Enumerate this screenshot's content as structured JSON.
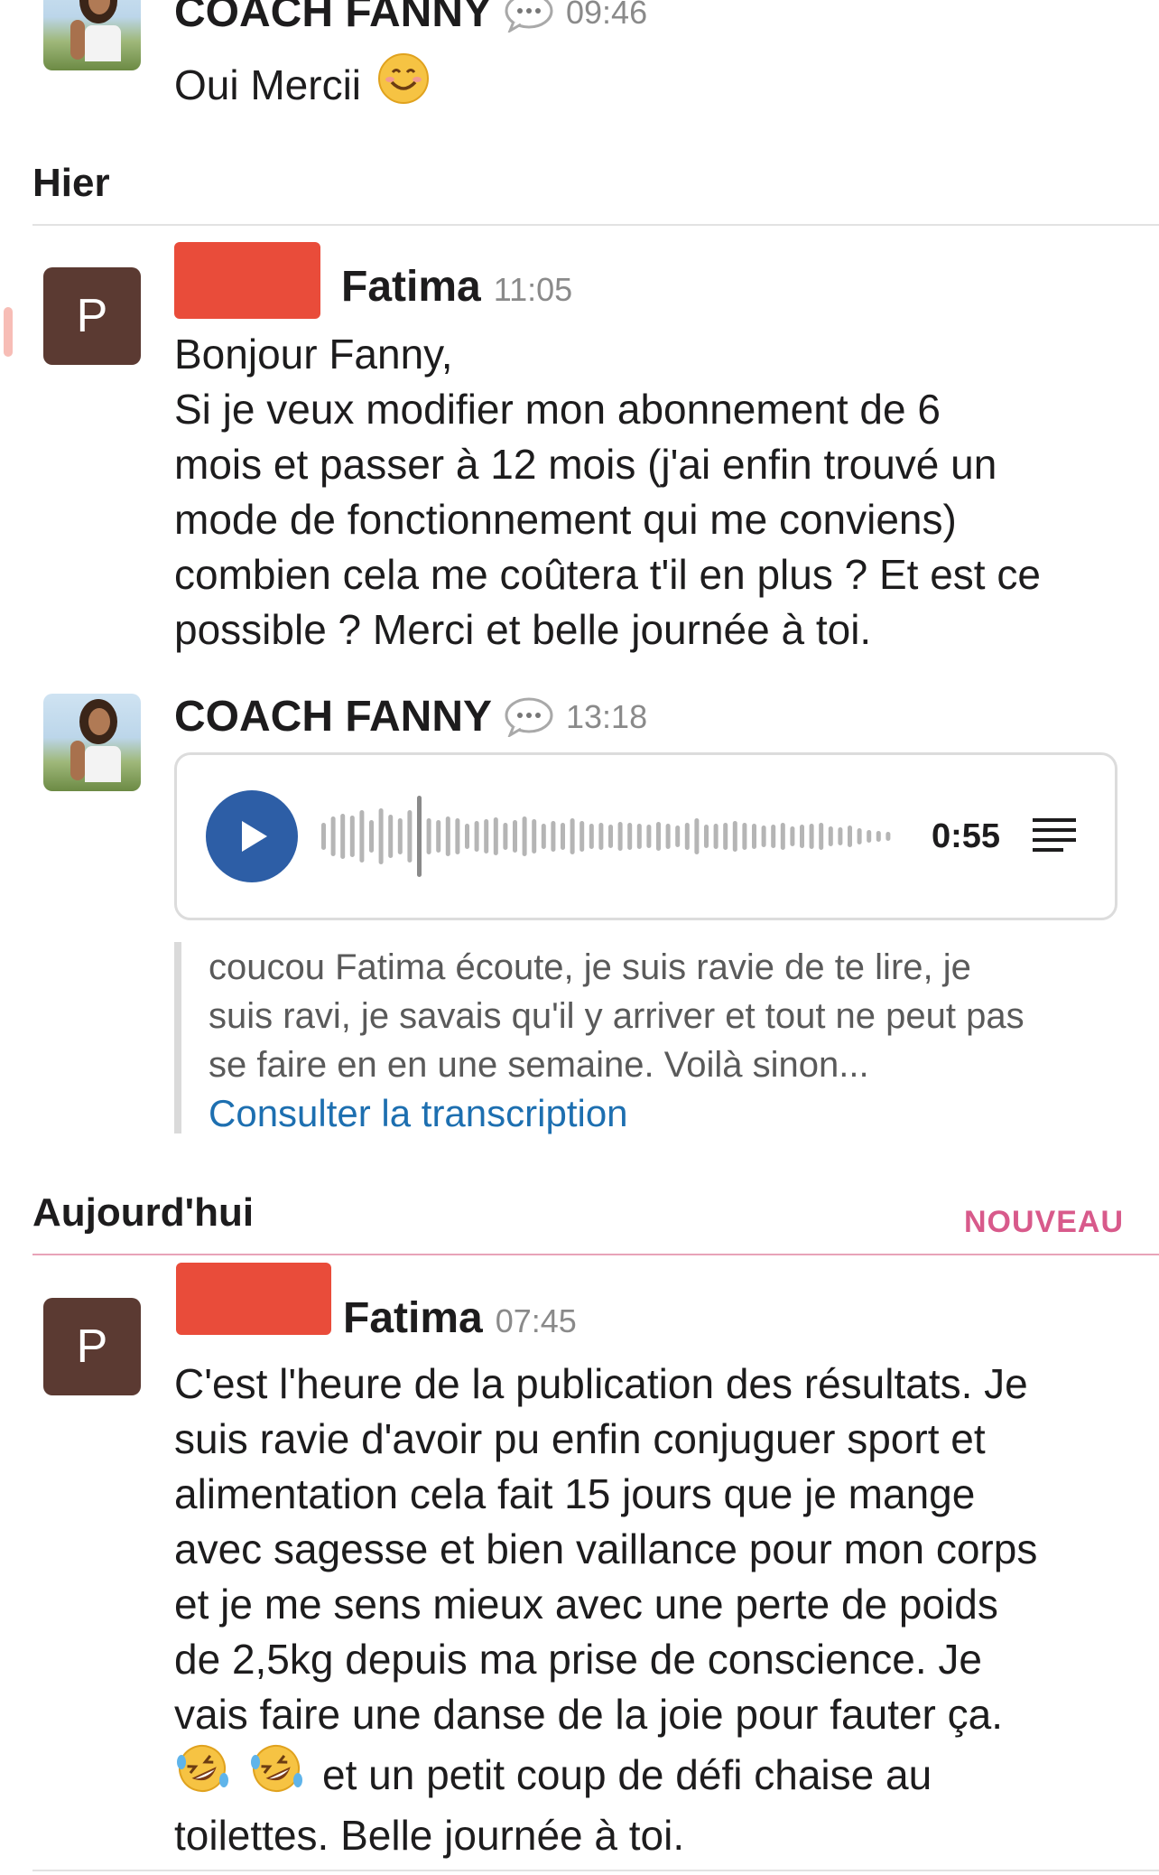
{
  "messages": {
    "m1": {
      "author": "COACH FANNY",
      "time": "09:46",
      "text": "Oui Mercii"
    },
    "m2": {
      "author": "Fatima",
      "time": "11:05",
      "avatar_letter": "P",
      "lines": [
        "Bonjour Fanny,",
        "Si je veux modifier mon abonnement de 6",
        "mois et passer à 12 mois (j'ai enfin trouvé un",
        "mode de fonctionnement qui me conviens)",
        "combien cela me coûtera t'il en plus ? Et est ce",
        "possible ? Merci et belle journée à toi."
      ]
    },
    "m3": {
      "author": "COACH FANNY",
      "time": "13:18",
      "audio": {
        "duration": "0:55"
      },
      "transcript_lines": [
        "coucou Fatima écoute, je suis ravie de te lire, je",
        "suis ravi, je savais qu'il y arriver et tout ne peut pas",
        "se faire en en une semaine. Voilà sinon..."
      ],
      "transcript_link": "Consulter la transcription"
    },
    "m4": {
      "author": "Fatima",
      "time": "07:45",
      "avatar_letter": "P",
      "lines": [
        "C'est l'heure de la publication des résultats. Je",
        "suis ravie d'avoir pu enfin conjuguer sport et",
        "alimentation cela fait 15 jours que je mange",
        "avec sagesse et bien vaillance pour mon corps",
        "et je me sens mieux avec une perte de poids",
        "de 2,5kg depuis ma prise de conscience. Je",
        "vais faire une danse de la joie pour fauter ça."
      ],
      "line_emoji_suffix": "et un petit coup de défi chaise au",
      "last_line": "toilettes. Belle journée à toi."
    }
  },
  "days": {
    "yesterday": "Hier",
    "today": "Aujourd'hui",
    "new_badge": "NOUVEAU"
  },
  "colors": {
    "accent_blue": "#2d5ea6",
    "link": "#1d6fb0",
    "new": "#d85a8b",
    "redaction": "#e8422f",
    "avatar_p": "#5b3a32"
  },
  "icons": [
    "speech-bubble-icon",
    "smiling-emoji-icon",
    "play-icon",
    "waveform-icon",
    "transcript-lines-icon",
    "rofl-emoji-icon"
  ]
}
